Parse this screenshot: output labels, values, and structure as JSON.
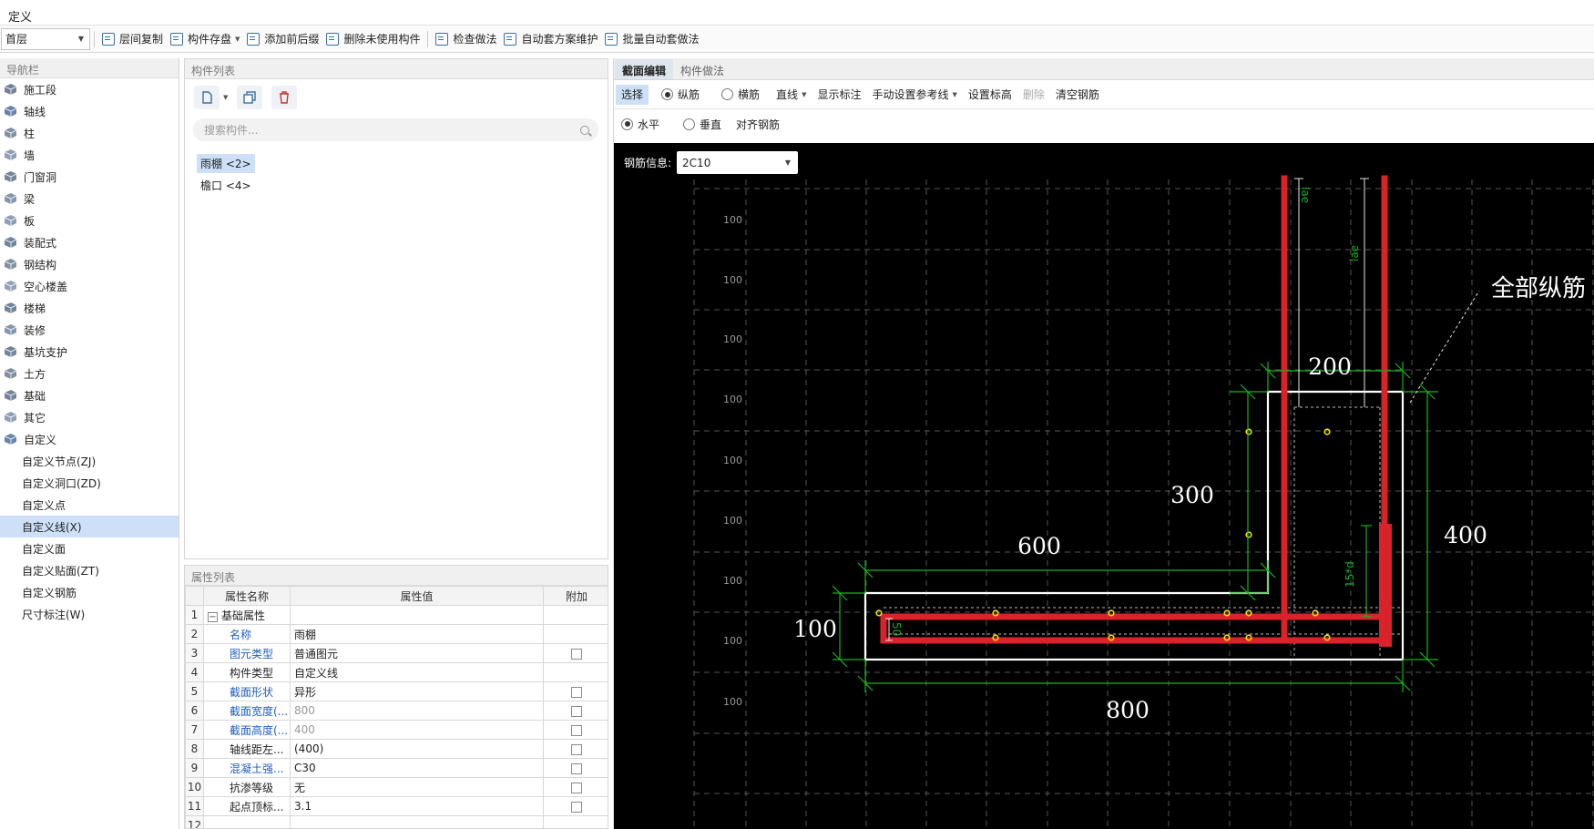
{
  "window": {
    "title": "定义"
  },
  "toolbar": {
    "floor": "首层",
    "buttons": [
      "层间复制",
      "构件存盘",
      "添加前后缀",
      "删除未使用构件",
      "检查做法",
      "自动套方案维护",
      "批量自动套做法"
    ]
  },
  "nav": {
    "header": "导航栏",
    "items": [
      "施工段",
      "轴线",
      "柱",
      "墙",
      "门窗洞",
      "梁",
      "板",
      "装配式",
      "钢结构",
      "空心楼盖",
      "楼梯",
      "装修",
      "基坑支护",
      "土方",
      "基础",
      "其它",
      "自定义"
    ],
    "subitems": [
      "自定义节点(ZJ)",
      "自定义洞口(ZD)",
      "自定义点",
      "自定义线(X)",
      "自定义面",
      "自定义贴面(ZT)",
      "自定义钢筋",
      "尺寸标注(W)"
    ],
    "active": "自定义线(X)"
  },
  "component_list": {
    "header": "构件列表",
    "search_placeholder": "搜索构件...",
    "items": [
      "雨棚 <2>",
      "檐口 <4>"
    ]
  },
  "properties": {
    "header": "属性列表",
    "columns": [
      "属性名称",
      "属性值",
      "附加"
    ],
    "group": "基础属性",
    "rows": [
      {
        "idx": "1",
        "name": "基础属性",
        "value": "",
        "check": false
      },
      {
        "idx": "2",
        "name": "名称",
        "value": "雨棚",
        "check": false
      },
      {
        "idx": "3",
        "name": "图元类型",
        "value": "普通图元",
        "check": true
      },
      {
        "idx": "4",
        "name": "构件类型",
        "value": "自定义线",
        "check": false
      },
      {
        "idx": "5",
        "name": "截面形状",
        "value": "异形",
        "check": true
      },
      {
        "idx": "6",
        "name": "截面宽度(...",
        "value": "800",
        "check": true
      },
      {
        "idx": "7",
        "name": "截面高度(...",
        "value": "400",
        "check": true
      },
      {
        "idx": "8",
        "name": "轴线距左...",
        "value": "(400)",
        "check": true
      },
      {
        "idx": "9",
        "name": "混凝土强...",
        "value": "C30",
        "check": true
      },
      {
        "idx": "10",
        "name": "抗渗等级",
        "value": "无",
        "check": true
      },
      {
        "idx": "11",
        "name": "起点顶标...",
        "value": "3.1",
        "check": true
      },
      {
        "idx": "12",
        "name": "",
        "value": "",
        "check": false
      }
    ]
  },
  "editor": {
    "tabs": [
      "截面编辑",
      "构件做法"
    ],
    "row1": {
      "select": "选择",
      "longitudinal": "纵筋",
      "transverse": "横筋",
      "line": "直线",
      "show_annotation": "显示标注",
      "ref_line": "手动设置参考线",
      "set_elevation": "设置标高",
      "delete": "删除",
      "clear": "清空钢筋"
    },
    "row2": {
      "horizontal": "水平",
      "vertical": "垂直",
      "align": "对齐钢筋"
    },
    "rebar_info_label": "钢筋信息:",
    "rebar_info_value": "2C10"
  },
  "drawing": {
    "grid_labels": [
      "100",
      "100",
      "100",
      "100",
      "100",
      "100",
      "100",
      "100",
      "100"
    ],
    "dims": {
      "d200": "200",
      "d300": "300",
      "d400": "400",
      "d600": "600",
      "d800": "800",
      "d100": "100"
    },
    "rebar_labels": {
      "lae1": "lae",
      "lae2": "lae",
      "d15": "15*d",
      "d50": "50"
    },
    "callout": "全部纵筋",
    "colors": {
      "background": "#000000",
      "outline": "#ffffff",
      "rebar": "#d9222a",
      "dimension": "#19b21d",
      "grid": "#555555",
      "point": "#f2e600"
    }
  }
}
